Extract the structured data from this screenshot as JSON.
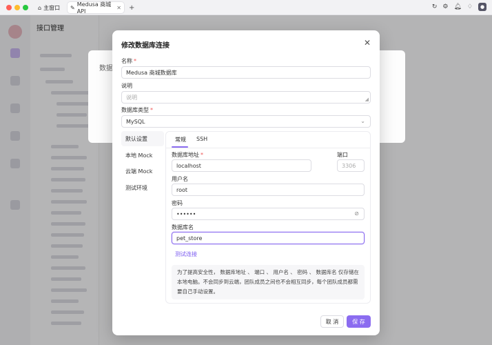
{
  "window": {
    "tabs": [
      {
        "label": "主窗口",
        "icon": "home-icon"
      },
      {
        "label": "Medusa 商城 API",
        "icon": "project-icon"
      }
    ]
  },
  "background": {
    "title": "接口管理",
    "dialog_title": "数据库"
  },
  "dialog": {
    "title": "修改数据库连接",
    "name": {
      "label": "名称",
      "value": "Medusa 商城数据库"
    },
    "description": {
      "label": "说明",
      "placeholder": "说明"
    },
    "db_type": {
      "label": "数据库类型",
      "value": "MySQL"
    },
    "environments": [
      "默认设置",
      "本地 Mock",
      "云端 Mock",
      "测试环境"
    ],
    "panel_tabs": [
      "常规",
      "SSH"
    ],
    "host": {
      "label": "数据库地址",
      "value": "localhost"
    },
    "port": {
      "label": "端口",
      "placeholder": "3306"
    },
    "username": {
      "label": "用户名",
      "value": "root"
    },
    "password": {
      "label": "密码",
      "value": "••••••"
    },
    "db_name": {
      "label": "数据库名",
      "value": "pet_store"
    },
    "test_link": "测试连接",
    "note": "为了提高安全性， 数据库地址 、 端口 、 用户名 、 密码 、 数据库名 仅存储在本地电脑。不会同步到云端，团队成员之间也不会相互同步，每个团队成员都需要自己手动设置。",
    "cancel_label": "取 消",
    "save_label": "保 存"
  },
  "colors": {
    "accent": "#8b6cf0",
    "required": "#e55555"
  }
}
